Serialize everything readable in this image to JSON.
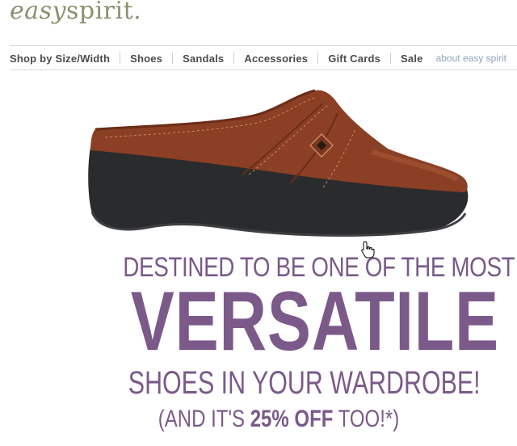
{
  "brand": {
    "logo_easy": "easy",
    "logo_spirit": "spirit",
    "logo_dot": ".",
    "color": "#8c8f6e"
  },
  "nav": {
    "items": [
      "Shop by Size/Width",
      "Shoes",
      "Sandals",
      "Accessories",
      "Gift Cards",
      "Sale"
    ],
    "about": "about easy spirit"
  },
  "hero": {
    "image": "brown-leather-clog-shoe",
    "cursor_icon": "hand-pointer-icon"
  },
  "promo": {
    "line1": "DESTINED TO BE ONE OF THE MOST",
    "line2": "VERSATILE",
    "line3": "SHOES IN YOUR WARDROBE!",
    "line4_prefix": "(AND IT'S ",
    "line4_bold": "25% OFF",
    "line4_suffix": " TOO!*)",
    "color": "#7b5a8a"
  }
}
